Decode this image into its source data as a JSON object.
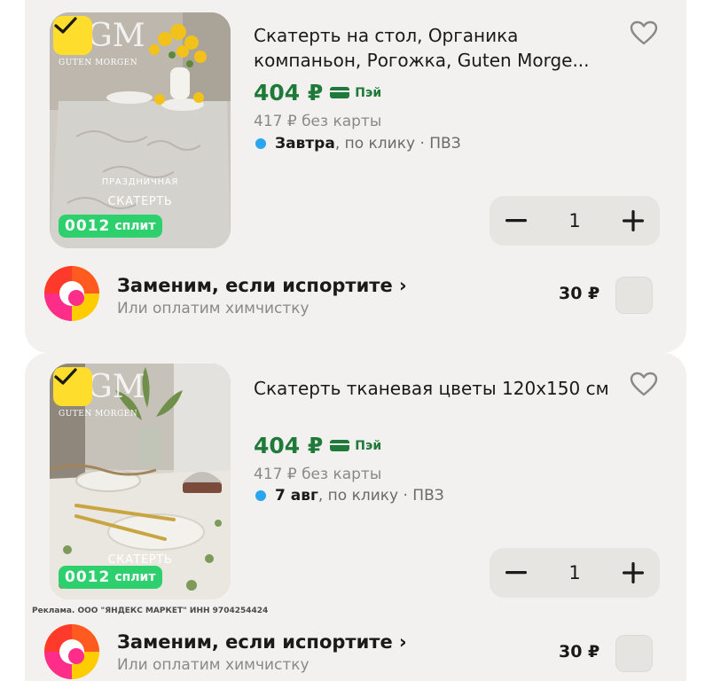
{
  "colors": {
    "card_bg": "#f2f1ef",
    "price_green": "#1f7a3a",
    "badge_yellow": "#ffdd2d",
    "split_green": "#2ed06e",
    "delivery_dot": "#2aa5f2"
  },
  "items": [
    {
      "title": "Скатерть на стол, Органика компаньон, Рогожка, Guten Morge...",
      "price": "404 ₽",
      "pay_label": "Пэй",
      "old_price": "417 ₽ без карты",
      "delivery_date": "Завтра",
      "delivery_rest": ", по клику · ПВЗ",
      "quantity": "1",
      "split_number": "0012",
      "split_label": "сплит",
      "thumb_brand": "GUTEN MORGEN",
      "thumb_logo": "GM",
      "thumb_line1": "ПРАЗДНИЧНАЯ",
      "thumb_line2": "СКАТЕРТЬ",
      "selected": true,
      "icons": [
        "check-icon",
        "heart-icon",
        "minus-icon",
        "plus-icon"
      ]
    },
    {
      "title": "Скатерть тканевая цветы 120х150 см",
      "price": "404 ₽",
      "pay_label": "Пэй",
      "old_price": "417 ₽ без карты",
      "delivery_date": "7 авг",
      "delivery_rest": ", по клику · ПВЗ",
      "quantity": "1",
      "split_number": "0012",
      "split_label": "сплит",
      "thumb_brand": "GUTEN MORGEN",
      "thumb_logo": "GM",
      "thumb_line2": "СКАТЕРТЬ",
      "selected": true,
      "icons": [
        "check-icon",
        "heart-icon",
        "minus-icon",
        "plus-icon"
      ]
    }
  ],
  "insurance": [
    {
      "title": "Заменим, если испортите",
      "chevron": "›",
      "subtitle": "Или оплатим химчистку",
      "price": "30 ₽",
      "checked": false
    },
    {
      "title": "Заменим, если испортите",
      "chevron": "›",
      "subtitle": "Или оплатим химчистку",
      "price": "30 ₽",
      "checked": false
    }
  ],
  "ad_note": "Реклама. ООО \"ЯНДЕКС МАРКЕТ\" ИНН 9704254424"
}
